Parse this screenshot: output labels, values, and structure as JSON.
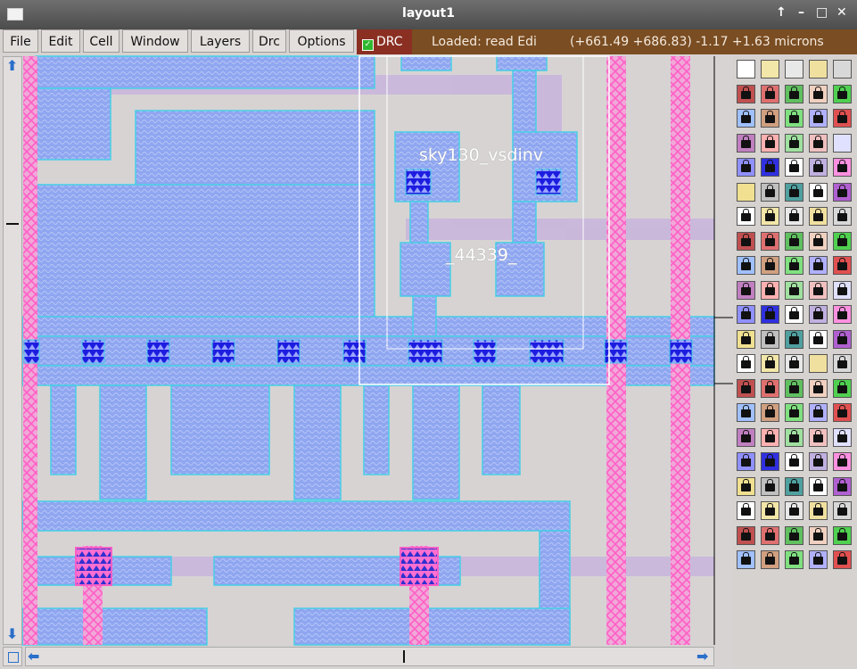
{
  "window": {
    "title": "layout1",
    "controls": [
      "↑",
      "–",
      "□",
      "✕"
    ]
  },
  "menu": {
    "items": [
      "File",
      "Edit",
      "Cell",
      "Window",
      "Layers",
      "Drc",
      "Options"
    ]
  },
  "drc": {
    "label": "DRC",
    "checked": true
  },
  "status": {
    "message": "Loaded: read Edi",
    "coordinates": "(+661.49 +686.83) -1.17 +1.63 microns"
  },
  "layout": {
    "cell_name": "sky130_vsdinv",
    "instance_id": "_44339_"
  },
  "colors": {
    "metal": "#8fa6f0",
    "outline": "#46cfe6",
    "poly": "#ff7fd3",
    "via": "#1d1de0",
    "background": "#d7d3d3",
    "menu_drc": "#8a2f22",
    "status": "#7a4d22"
  },
  "scrollbars": {
    "up_icon": "up-arrow-icon",
    "down_icon": "down-arrow-icon",
    "left_icon": "left-arrow-icon",
    "right_icon": "right-arrow-icon"
  }
}
